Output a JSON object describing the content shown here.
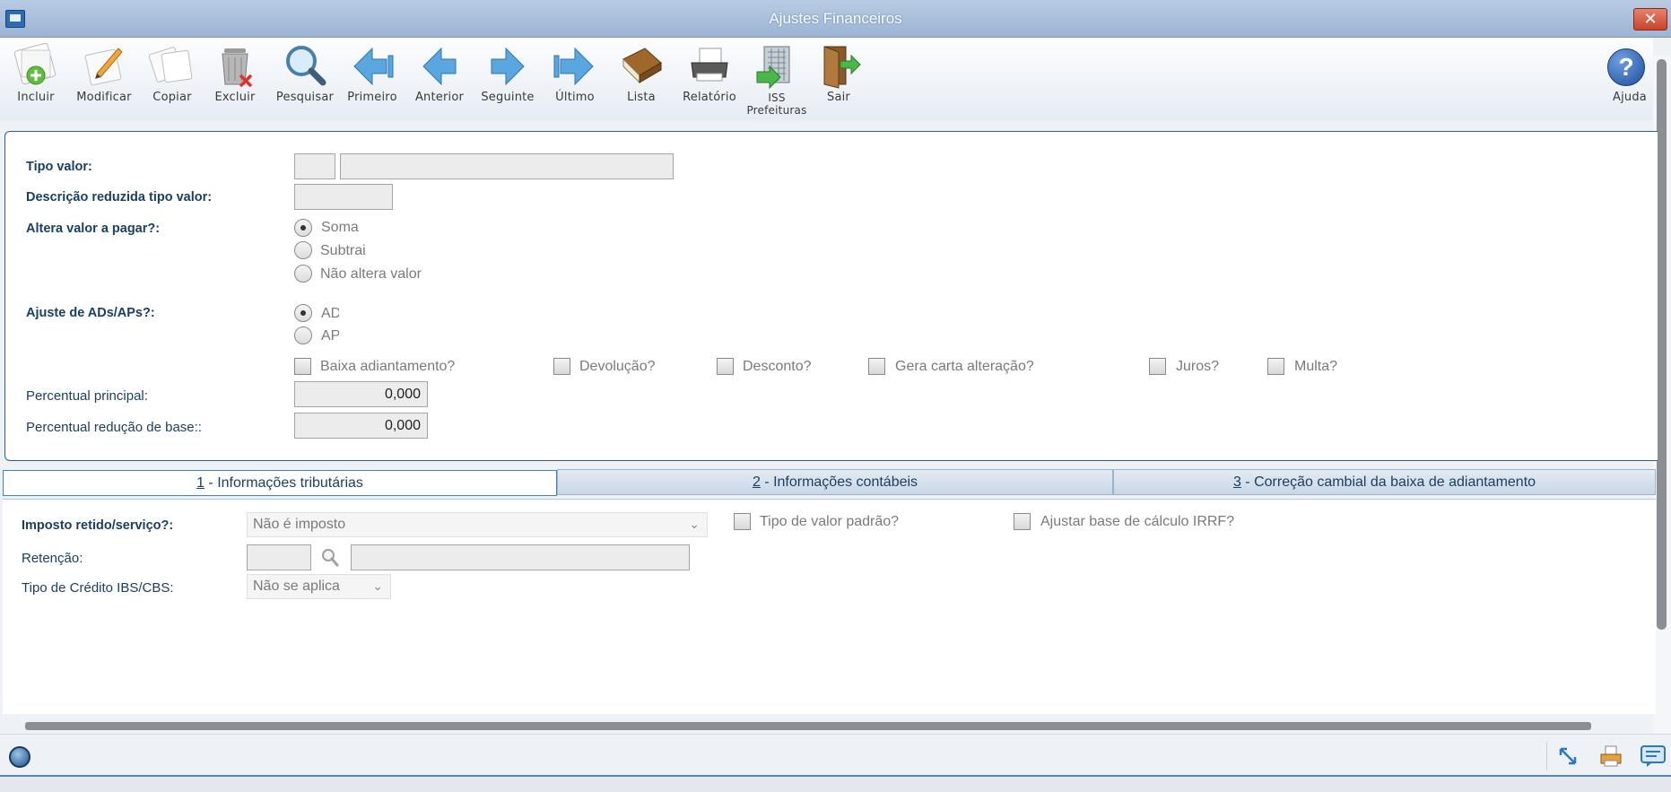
{
  "window": {
    "title": "Ajustes Financeiros",
    "close_glyph": "✕"
  },
  "toolbar": {
    "items": [
      {
        "label": "Incluir",
        "icon": "include-icon"
      },
      {
        "label": "Modificar",
        "icon": "modify-icon"
      },
      {
        "label": "Copiar",
        "icon": "copy-icon"
      },
      {
        "label": "Excluir",
        "icon": "delete-icon"
      },
      {
        "label": "Pesquisar",
        "icon": "search-icon"
      },
      {
        "label": "Primeiro",
        "icon": "first-icon"
      },
      {
        "label": "Anterior",
        "icon": "previous-icon"
      },
      {
        "label": "Seguinte",
        "icon": "next-icon"
      },
      {
        "label": "Último",
        "icon": "last-icon"
      },
      {
        "label": "Lista",
        "icon": "list-icon"
      },
      {
        "label": "Relatório",
        "icon": "report-icon"
      },
      {
        "label": "ISS",
        "label2": "Prefeituras",
        "icon": "iss-icon"
      },
      {
        "label": "Sair",
        "icon": "exit-icon"
      }
    ],
    "help_label": "Ajuda",
    "help_glyph": "?"
  },
  "form": {
    "tipo_valor_label": "Tipo valor:",
    "tipo_valor_code": "",
    "tipo_valor_desc": "",
    "descricao_reduzida_label": "Descrição reduzida tipo valor:",
    "descricao_reduzida_value": "",
    "altera_valor_label": "Altera valor a pagar?:",
    "altera_options": [
      "Soma",
      "Subtrai",
      "Não altera valor"
    ],
    "altera_selected": "Soma",
    "ajuste_label": "Ajuste de ADs/APs?:",
    "ajuste_options": [
      "AD",
      "AP"
    ],
    "ajuste_selected": "AD",
    "checkboxes": [
      "Baixa adiantamento?",
      "Devolução?",
      "Desconto?",
      "Gera carta alteração?",
      "Juros?",
      "Multa?"
    ],
    "percentual_principal_label": "Percentual principal:",
    "percentual_principal_value": "0,000",
    "percentual_reducao_label": "Percentual redução de base::",
    "percentual_reducao_value": "0,000"
  },
  "tabs": [
    {
      "num": "1",
      "label": " - Informações tributárias"
    },
    {
      "num": "2",
      "label": " - Informações contábeis"
    },
    {
      "num": "3",
      "label": " - Correção cambial da baixa de adiantamento"
    }
  ],
  "tab1": {
    "imposto_label": "Imposto retido/serviço?:",
    "imposto_value": "Não é imposto",
    "tipo_padrao_label": "Tipo de valor padrão?",
    "ajustar_irrf_label": "Ajustar base de cálculo IRRF?",
    "retencao_label": "Retenção:",
    "retencao_code": "",
    "retencao_desc": "",
    "credito_label": "Tipo de Crédito IBS/CBS:",
    "credito_value": "Não se aplica"
  },
  "colors": {
    "accent": "#2e5f88",
    "label": "#1b3f62",
    "title_bar": "#9cb4d3"
  }
}
